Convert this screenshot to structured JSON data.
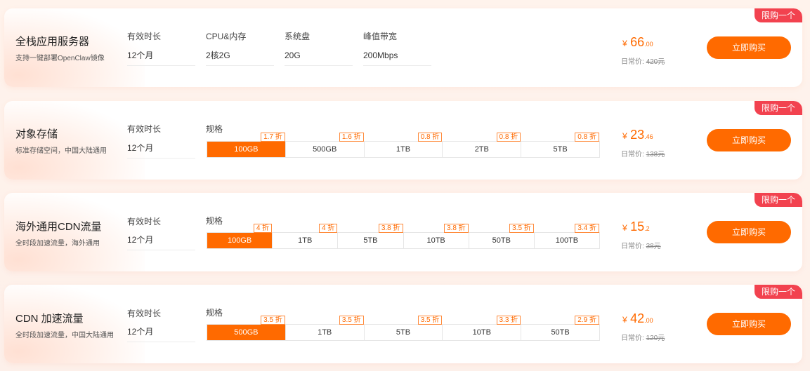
{
  "products": [
    {
      "badge": "限购一个",
      "name": "全栈应用服务器",
      "desc": "支持一键部署OpenClaw镜像",
      "fields": [
        {
          "label": "有效时长",
          "value": "12个月"
        },
        {
          "label": "CPU&内存",
          "value": "2核2G"
        },
        {
          "label": "系统盘",
          "value": "20G"
        },
        {
          "label": "峰值带宽",
          "value": "200Mbps"
        }
      ],
      "currency": "¥",
      "price_int": "66",
      "price_dec": ".00",
      "orig_label": "日常价:",
      "orig_value": "420元",
      "buy_label": "立即购买"
    },
    {
      "badge": "限购一个",
      "name": "对象存储",
      "desc": "标准存储空间，中国大陆通用",
      "duration_label": "有效时长",
      "duration_value": "12个月",
      "spec_label": "规格",
      "options": [
        {
          "label": "100GB",
          "discount": "1.7 折",
          "selected": true
        },
        {
          "label": "500GB",
          "discount": "1.6 折"
        },
        {
          "label": "1TB",
          "discount": "0.8 折"
        },
        {
          "label": "2TB",
          "discount": "0.8 折"
        },
        {
          "label": "5TB",
          "discount": "0.8 折"
        }
      ],
      "currency": "¥",
      "price_int": "23",
      "price_dec": ".46",
      "orig_label": "日常价:",
      "orig_value": "138元",
      "buy_label": "立即购买"
    },
    {
      "badge": "限购一个",
      "name": "海外通用CDN流量",
      "desc": "全时段加速流量，海外通用",
      "duration_label": "有效时长",
      "duration_value": "12个月",
      "spec_label": "规格",
      "options": [
        {
          "label": "100GB",
          "discount": "4 折",
          "selected": true
        },
        {
          "label": "1TB",
          "discount": "4 折"
        },
        {
          "label": "5TB",
          "discount": "3.8 折"
        },
        {
          "label": "10TB",
          "discount": "3.8 折"
        },
        {
          "label": "50TB",
          "discount": "3.5 折"
        },
        {
          "label": "100TB",
          "discount": "3.4 折"
        }
      ],
      "currency": "¥",
      "price_int": "15",
      "price_dec": ".2",
      "orig_label": "日常价:",
      "orig_value": "38元",
      "buy_label": "立即购买"
    },
    {
      "badge": "限购一个",
      "name": "CDN 加速流量",
      "desc": "全时段加速流量，中国大陆通用",
      "duration_label": "有效时长",
      "duration_value": "12个月",
      "spec_label": "规格",
      "options": [
        {
          "label": "500GB",
          "discount": "3.5 折",
          "selected": true
        },
        {
          "label": "1TB",
          "discount": "3.5 折"
        },
        {
          "label": "5TB",
          "discount": "3.5 折"
        },
        {
          "label": "10TB",
          "discount": "3.3 折"
        },
        {
          "label": "50TB",
          "discount": "2.9 折"
        }
      ],
      "currency": "¥",
      "price_int": "42",
      "price_dec": ".00",
      "orig_label": "日常价:",
      "orig_value": "120元",
      "buy_label": "立即购买"
    }
  ],
  "colors": {
    "accent": "#ff6a00",
    "badge": "#f2424f"
  }
}
